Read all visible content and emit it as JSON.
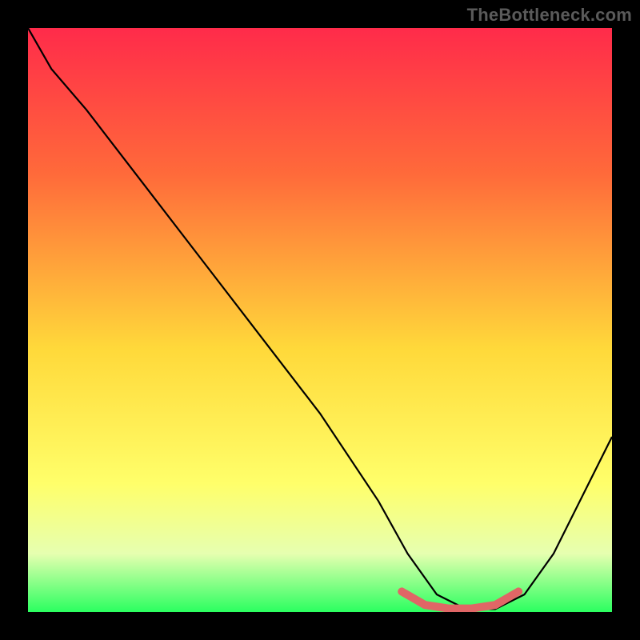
{
  "watermark": "TheBottleneck.com",
  "colors": {
    "gradient_top": "#ff2b4a",
    "gradient_mid1": "#ff6a3a",
    "gradient_mid2": "#ffd93a",
    "gradient_mid3": "#ffff6a",
    "gradient_bottom": "#2bff60",
    "curve": "#000000",
    "highlight": "#e06666",
    "background": "#000000"
  },
  "chart_data": {
    "type": "line",
    "title": "",
    "xlabel": "",
    "ylabel": "",
    "xlim": [
      0,
      100
    ],
    "ylim": [
      0,
      100
    ],
    "series": [
      {
        "name": "curve",
        "x": [
          0,
          4,
          10,
          20,
          30,
          40,
          50,
          60,
          65,
          70,
          75,
          80,
          85,
          90,
          100
        ],
        "y": [
          100,
          93,
          86,
          73,
          60,
          47,
          34,
          19,
          10,
          3,
          0.5,
          0.5,
          3,
          10,
          30
        ]
      },
      {
        "name": "highlight",
        "x": [
          64,
          68,
          72,
          76,
          80,
          84
        ],
        "y": [
          3.5,
          1.2,
          0.6,
          0.6,
          1.2,
          3.5
        ]
      }
    ]
  }
}
